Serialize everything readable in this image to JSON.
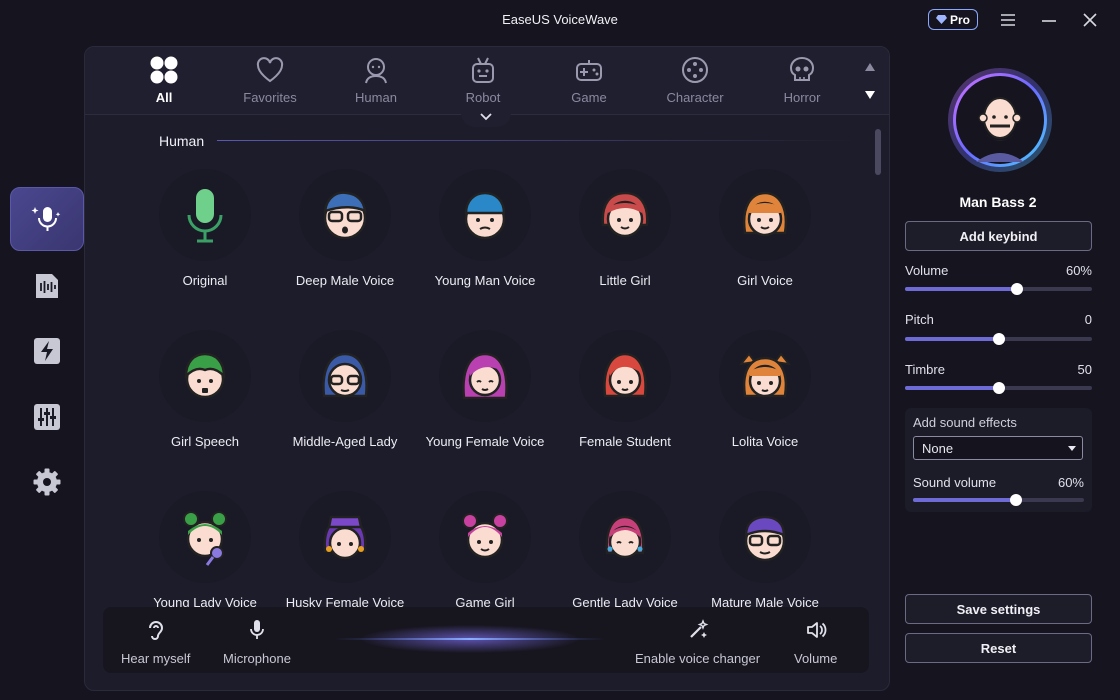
{
  "app": {
    "title": "EaseUS VoiceWave",
    "pro_label": "Pro"
  },
  "categories": [
    {
      "label": "All",
      "icon": "grid-icon",
      "active": true
    },
    {
      "label": "Favorites",
      "icon": "heart-icon"
    },
    {
      "label": "Human",
      "icon": "human-icon"
    },
    {
      "label": "Robot",
      "icon": "robot-icon"
    },
    {
      "label": "Game",
      "icon": "gamepad-icon"
    },
    {
      "label": "Character",
      "icon": "character-icon"
    },
    {
      "label": "Horror",
      "icon": "skull-icon"
    }
  ],
  "section": {
    "title": "Human"
  },
  "voices": [
    {
      "name": "Original"
    },
    {
      "name": "Deep Male Voice"
    },
    {
      "name": "Young Man Voice"
    },
    {
      "name": "Little Girl"
    },
    {
      "name": "Girl Voice"
    },
    {
      "name": "Girl Speech"
    },
    {
      "name": "Middle-Aged Lady"
    },
    {
      "name": "Young Female Voice"
    },
    {
      "name": "Female Student"
    },
    {
      "name": "Lolita Voice"
    },
    {
      "name": "Young Lady Voice"
    },
    {
      "name": "Husky Female Voice"
    },
    {
      "name": "Game Girl"
    },
    {
      "name": "Gentle Lady Voice"
    },
    {
      "name": "Mature Male Voice"
    }
  ],
  "bottom_bar": {
    "hear_myself": "Hear myself",
    "microphone": "Microphone",
    "enable_voice_changer": "Enable voice changer",
    "volume": "Volume"
  },
  "right_panel": {
    "selected_voice": "Man Bass 2",
    "add_keybind": "Add keybind",
    "volume": {
      "label": "Volume",
      "value_text": "60%",
      "fraction": 0.6
    },
    "pitch": {
      "label": "Pitch",
      "value_text": "0",
      "fraction": 0.5
    },
    "timbre": {
      "label": "Timbre",
      "value_text": "50",
      "fraction": 0.5
    },
    "sound_effects": {
      "label": "Add sound effects",
      "selected": "None"
    },
    "sound_volume": {
      "label": "Sound volume",
      "value_text": "60%",
      "fraction": 0.6
    },
    "save_settings": "Save settings",
    "reset": "Reset"
  },
  "colors": {
    "accent": "#6e6ad6",
    "background": "#15141f",
    "panel": "#1d1c2b",
    "pro_border": "#8aa8ff"
  }
}
